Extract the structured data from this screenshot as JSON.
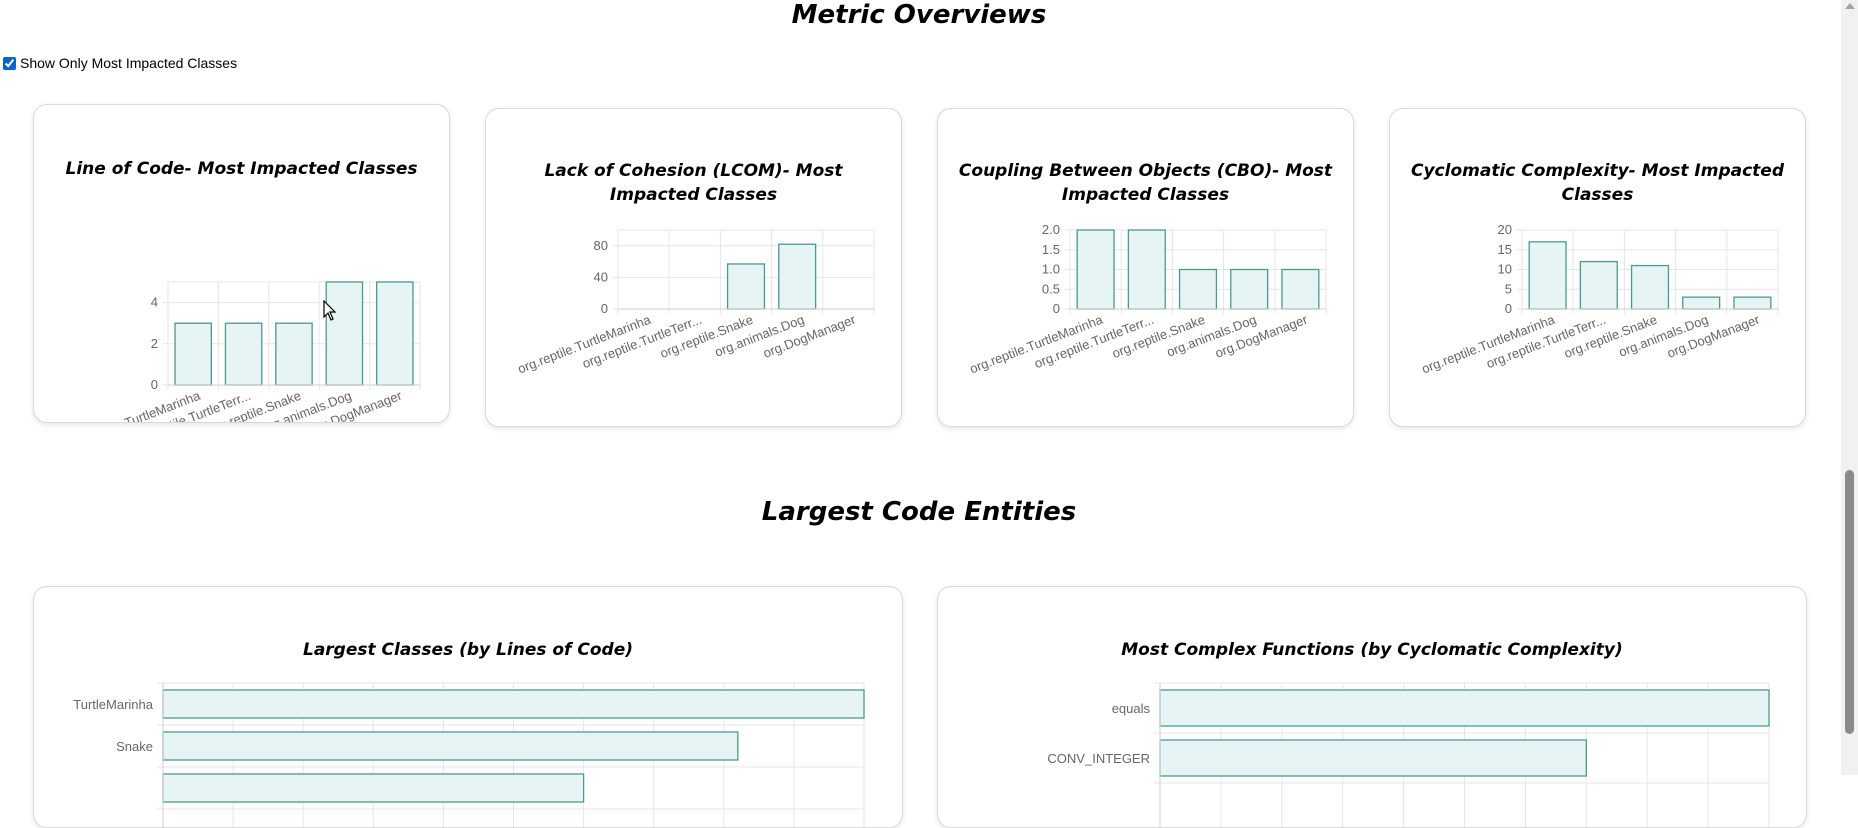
{
  "page": {
    "metric_title": "Metric Overviews",
    "toggle_label": "Show Only Most Impacted Classes",
    "toggle_checked": true,
    "largest_title": "Largest Code Entities"
  },
  "colors": {
    "bar_fill": "#e7f4f6",
    "bar_stroke": "#4a9a8a",
    "grid": "#e6e6e6",
    "tick_text": "#666666"
  },
  "icons": {
    "cursor": "mouse-pointer-icon",
    "scroll_up": "chevron-up-icon"
  },
  "chart_data": [
    {
      "id": "loc",
      "type": "bar",
      "title": "Line of Code- Most Impacted Classes",
      "categories": [
        "org.reptile.TurtleMarinha",
        "org.reptile.TurtleTerr...",
        "org.reptile.Snake",
        "org.animals.Dog",
        "org.DogManager"
      ],
      "values": [
        3,
        3,
        3,
        5,
        5
      ],
      "ylim": [
        0,
        5
      ],
      "yticks": [
        "0",
        "2",
        "4"
      ],
      "ytick_values": [
        0,
        2,
        4
      ]
    },
    {
      "id": "lcom",
      "type": "bar",
      "title": "Lack of Cohesion (LCOM)- Most Impacted Classes",
      "categories": [
        "org.reptile.TurtleMarinha",
        "org.reptile.TurtleTerr...",
        "org.reptile.Snake",
        "org.animals.Dog",
        "org.DogManager"
      ],
      "values": [
        0,
        0,
        57,
        82,
        0
      ],
      "ylim": [
        0,
        100
      ],
      "yticks": [
        "0",
        "40",
        "80"
      ],
      "ytick_values": [
        0,
        40,
        80
      ]
    },
    {
      "id": "cbo",
      "type": "bar",
      "title": "Coupling Between Objects (CBO)- Most Impacted Classes",
      "categories": [
        "org.reptile.TurtleMarinha",
        "org.reptile.TurtleTerr...",
        "org.reptile.Snake",
        "org.animals.Dog",
        "org.DogManager"
      ],
      "values": [
        2,
        2,
        1,
        1,
        1
      ],
      "ylim": [
        0,
        2
      ],
      "yticks": [
        "0",
        "0.5",
        "1.0",
        "1.5",
        "2.0"
      ],
      "ytick_values": [
        0,
        0.5,
        1,
        1.5,
        2
      ]
    },
    {
      "id": "cc",
      "type": "bar",
      "title": "Cyclomatic Complexity- Most Impacted Classes",
      "categories": [
        "org.reptile.TurtleMarinha",
        "org.reptile.TurtleTerr...",
        "org.reptile.Snake",
        "org.animals.Dog",
        "org.DogManager"
      ],
      "values": [
        17,
        12,
        11,
        3,
        3
      ],
      "ylim": [
        0,
        20
      ],
      "yticks": [
        "0",
        "5",
        "10",
        "15",
        "20"
      ],
      "ytick_values": [
        0,
        5,
        10,
        15,
        20
      ]
    },
    {
      "id": "largest",
      "type": "bar",
      "orientation": "horizontal",
      "title": "Largest Classes (by Lines of Code)",
      "categories": [
        "TurtleMarinha",
        "Snake"
      ],
      "values": [
        100,
        82,
        60
      ],
      "note": "third bar cut off at bottom edge"
    },
    {
      "id": "complex",
      "type": "bar",
      "orientation": "horizontal",
      "title": "Most Complex Functions (by Cyclomatic Complexity)",
      "categories": [
        "equals",
        "CONV_INTEGER"
      ],
      "values": [
        100,
        70
      ]
    }
  ]
}
